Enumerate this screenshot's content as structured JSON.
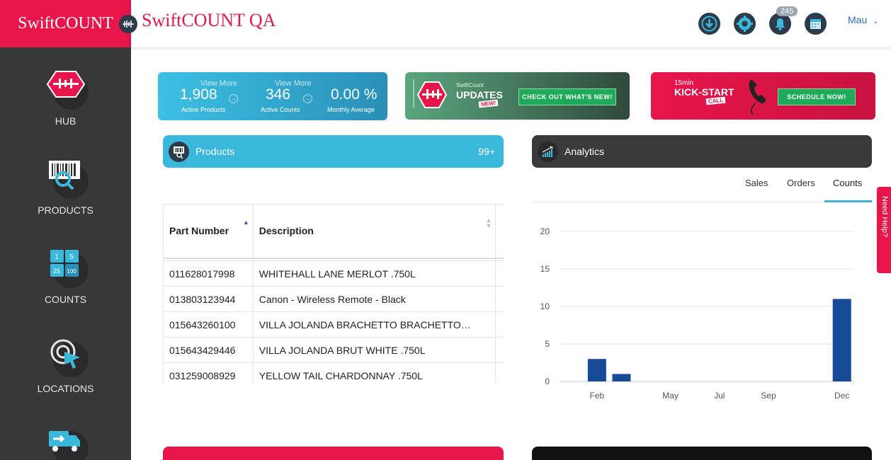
{
  "brand": {
    "name": "SwiftCOUNT"
  },
  "topbar": {
    "title": "SwiftCOUNT QA",
    "notification_count": "245",
    "user": "Mau"
  },
  "sidebar": {
    "items": [
      {
        "label": "HUB",
        "icon": "hub-icon"
      },
      {
        "label": "PRODUCTS",
        "icon": "barcode-search-icon"
      },
      {
        "label": "COUNTS",
        "icon": "counts-grid-icon"
      },
      {
        "label": "LOCATIONS",
        "icon": "location-pointer-icon"
      },
      {
        "label": "",
        "icon": "truck-icon"
      }
    ]
  },
  "stats": [
    {
      "view_more": "View More",
      "value": "1,908",
      "label": "Active Products"
    },
    {
      "view_more": "View More",
      "value": "346",
      "label": "Active Counts"
    },
    {
      "value": "0.00 %",
      "label": "Monthly Average"
    }
  ],
  "updates_banner": {
    "small": "SwiftCount",
    "title": "UPDATES",
    "tag": "NEW!",
    "cta": "CHECK OUT WHAT'S NEW!"
  },
  "kickstart_banner": {
    "small": "15min",
    "title": "KICK-START",
    "tag": "CALL",
    "cta": "SCHEDULE NOW!"
  },
  "products_panel": {
    "title": "Products",
    "count": "99+",
    "columns": [
      "Part Number",
      "Description"
    ],
    "rows": [
      {
        "part": "011628017998",
        "desc": "WHITEHALL LANE MERLOT .750L"
      },
      {
        "part": "013803123944",
        "desc": "Canon - Wireless Remote - Black"
      },
      {
        "part": "015643260100",
        "desc": "VILLA JOLANDA BRACHETTO BRACHETTO…"
      },
      {
        "part": "015643429446",
        "desc": "VILLA JOLANDA BRUT WHITE .750L"
      },
      {
        "part": "031259008929",
        "desc": "YELLOW TAIL CHARDONNAY .750L"
      }
    ]
  },
  "analytics_panel": {
    "title": "Analytics",
    "tabs": [
      "Sales",
      "Orders",
      "Counts"
    ],
    "active_tab": "Counts"
  },
  "chart_data": {
    "type": "bar",
    "x": [
      "Feb",
      "Mar",
      "Dec"
    ],
    "values": [
      3,
      1,
      11
    ],
    "xticks": [
      "Feb",
      "May",
      "Jul",
      "Sep",
      "Dec"
    ],
    "yticks": [
      0,
      5,
      10,
      15,
      20
    ],
    "ylim": [
      0,
      20
    ],
    "grid": true,
    "bar_color": "#174b97"
  },
  "help_tab": {
    "label": "Need Help?"
  },
  "colors": {
    "brand_red": "#e8154b",
    "sidebar": "#383838",
    "products_blue": "#3ab8dc",
    "analytics_dark": "#3a3a3a",
    "bar": "#174b97"
  }
}
